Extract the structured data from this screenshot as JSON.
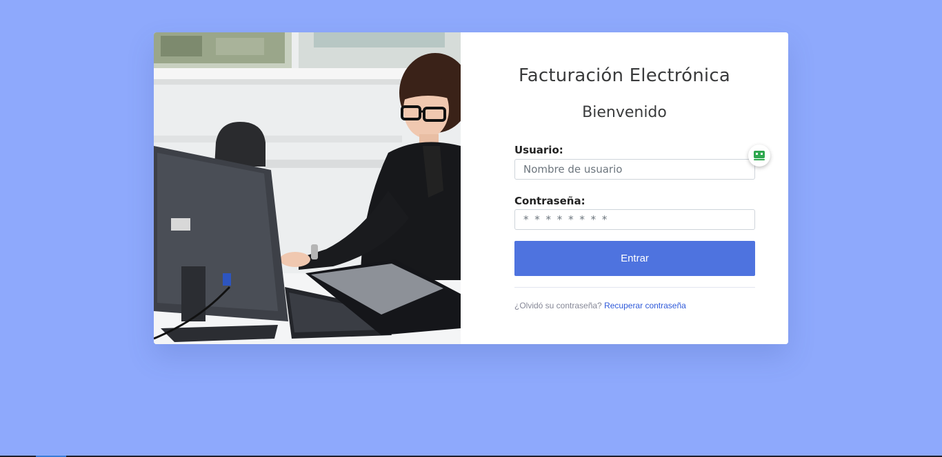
{
  "login": {
    "app_title": "Facturación Electrónica",
    "welcome": "Bienvenido",
    "username_label": "Usuario:",
    "username_placeholder": "Nombre de usuario",
    "password_label": "Contraseña:",
    "password_placeholder": "* * * * * * * *",
    "submit_label": "Entrar",
    "forgot_text": "¿Olvidó su contraseña?",
    "recover_link": "Recuperar contraseña"
  },
  "icons": {
    "extension_badge": "password-manager-icon"
  },
  "colors": {
    "background": "#8ea9fc",
    "primary_button": "#4e73df",
    "link": "#2e59d9",
    "extension_icon": "#2fa84f"
  }
}
